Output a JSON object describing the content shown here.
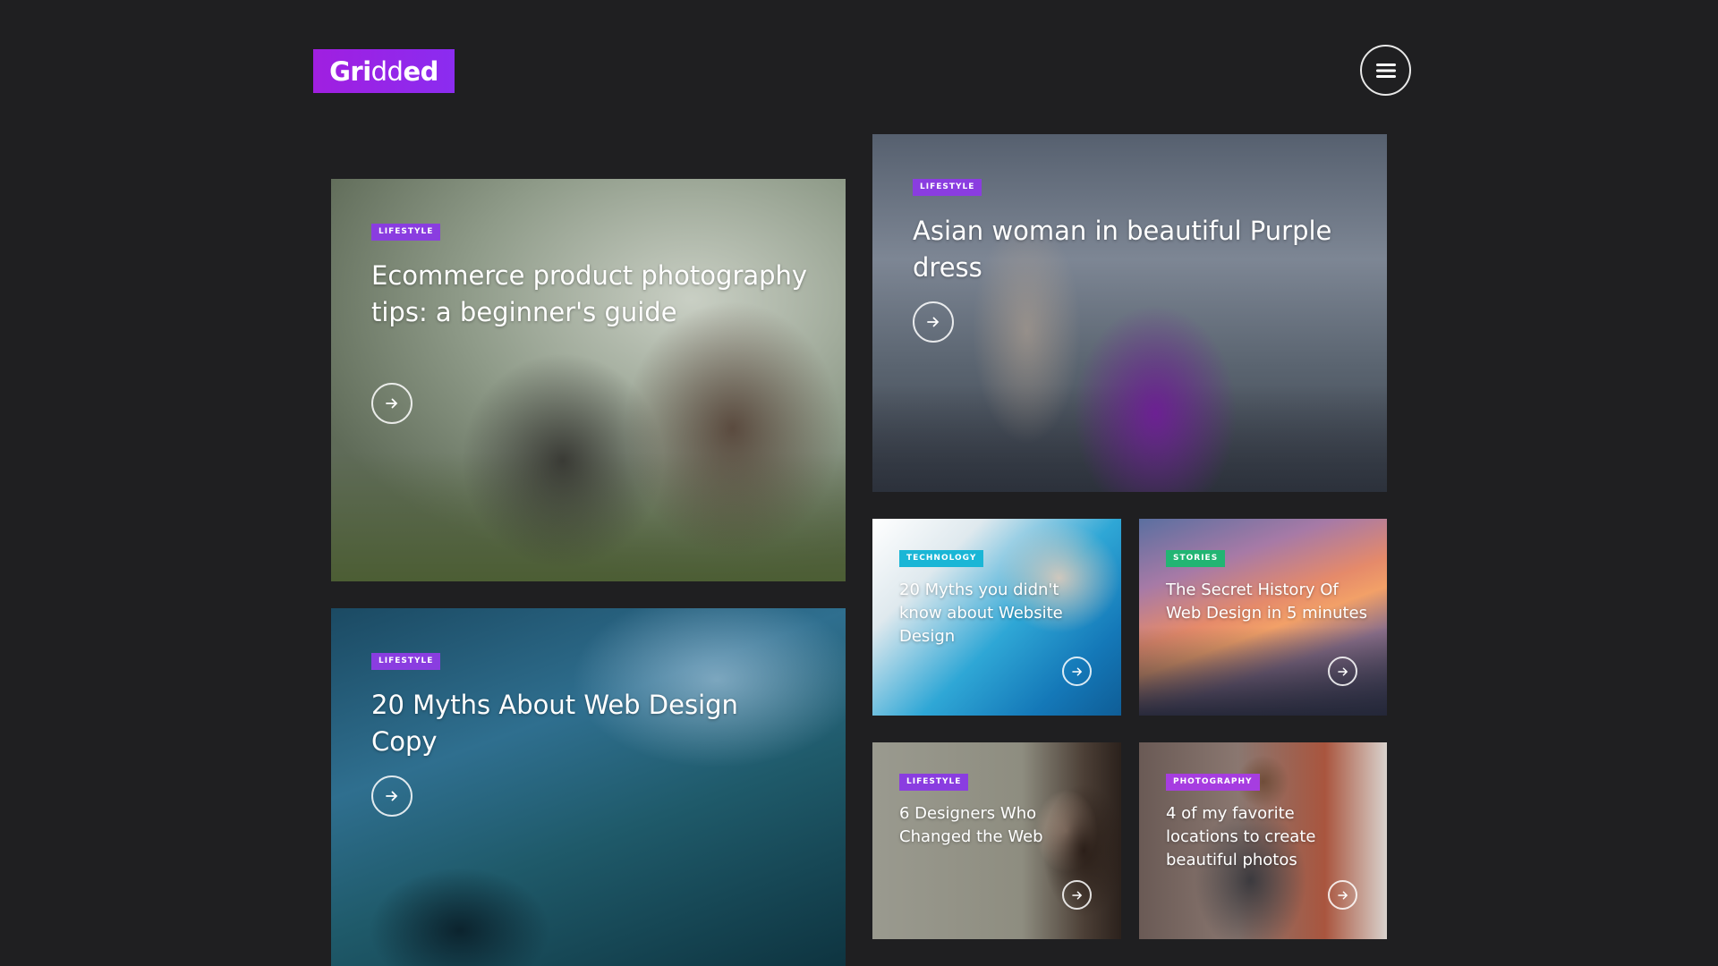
{
  "app": {
    "logo": {
      "part1": "Gri",
      "part2": "dd",
      "part3": "ed"
    },
    "menu_icon": "hamburger-menu-icon"
  },
  "colors": {
    "background": "#1f1f21",
    "logo_bg": "#9b22e6",
    "lifestyle": "#8a3de0",
    "technology": "#1ab6d6",
    "stories": "#22b573",
    "photography": "#a63de0"
  },
  "cards": [
    {
      "id": "ecommerce",
      "category": "LIFESTYLE",
      "title": "Ecommerce product photography tips: a beginner's guide",
      "icon": "arrow-right-icon"
    },
    {
      "id": "asian-woman",
      "category": "LIFESTYLE",
      "title": "Asian woman in beautiful Purple dress",
      "icon": "arrow-right-icon"
    },
    {
      "id": "myths-web-design-copy",
      "category": "LIFESTYLE",
      "title": "20 Myths About Web Design Copy",
      "icon": "arrow-right-icon"
    },
    {
      "id": "myths-website-design",
      "category": "TECHNOLOGY",
      "title": "20 Myths you didn't know about Website Design",
      "icon": "arrow-right-icon"
    },
    {
      "id": "secret-history",
      "category": "STORIES",
      "title": "The Secret History Of Web Design in 5 minutes",
      "icon": "arrow-right-icon"
    },
    {
      "id": "six-designers",
      "category": "LIFESTYLE",
      "title": "6 Designers Who Changed the Web",
      "icon": "arrow-right-icon"
    },
    {
      "id": "favorite-locations",
      "category": "PHOTOGRAPHY",
      "title": "4 of my favorite locations to create beautiful photos",
      "icon": "arrow-right-icon"
    }
  ]
}
